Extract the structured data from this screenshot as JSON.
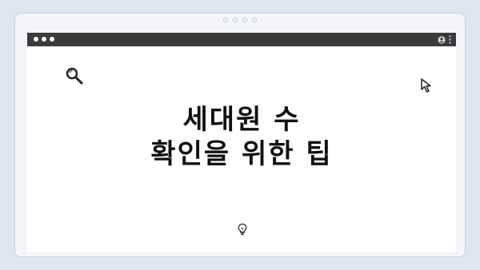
{
  "browser": {
    "window_controls": [
      "close",
      "minimize",
      "maximize"
    ],
    "toolbar_icons": [
      "profile-icon",
      "kebab-menu-icon"
    ]
  },
  "content": {
    "headline_line1": "세대원 수",
    "headline_line2": "확인을 위한 팁",
    "icons": [
      "search-icon",
      "cursor-icon",
      "lightbulb-icon"
    ]
  },
  "colors": {
    "background": "#dfe6ed",
    "titlebar": "#3b3b3b",
    "text": "#111111"
  }
}
